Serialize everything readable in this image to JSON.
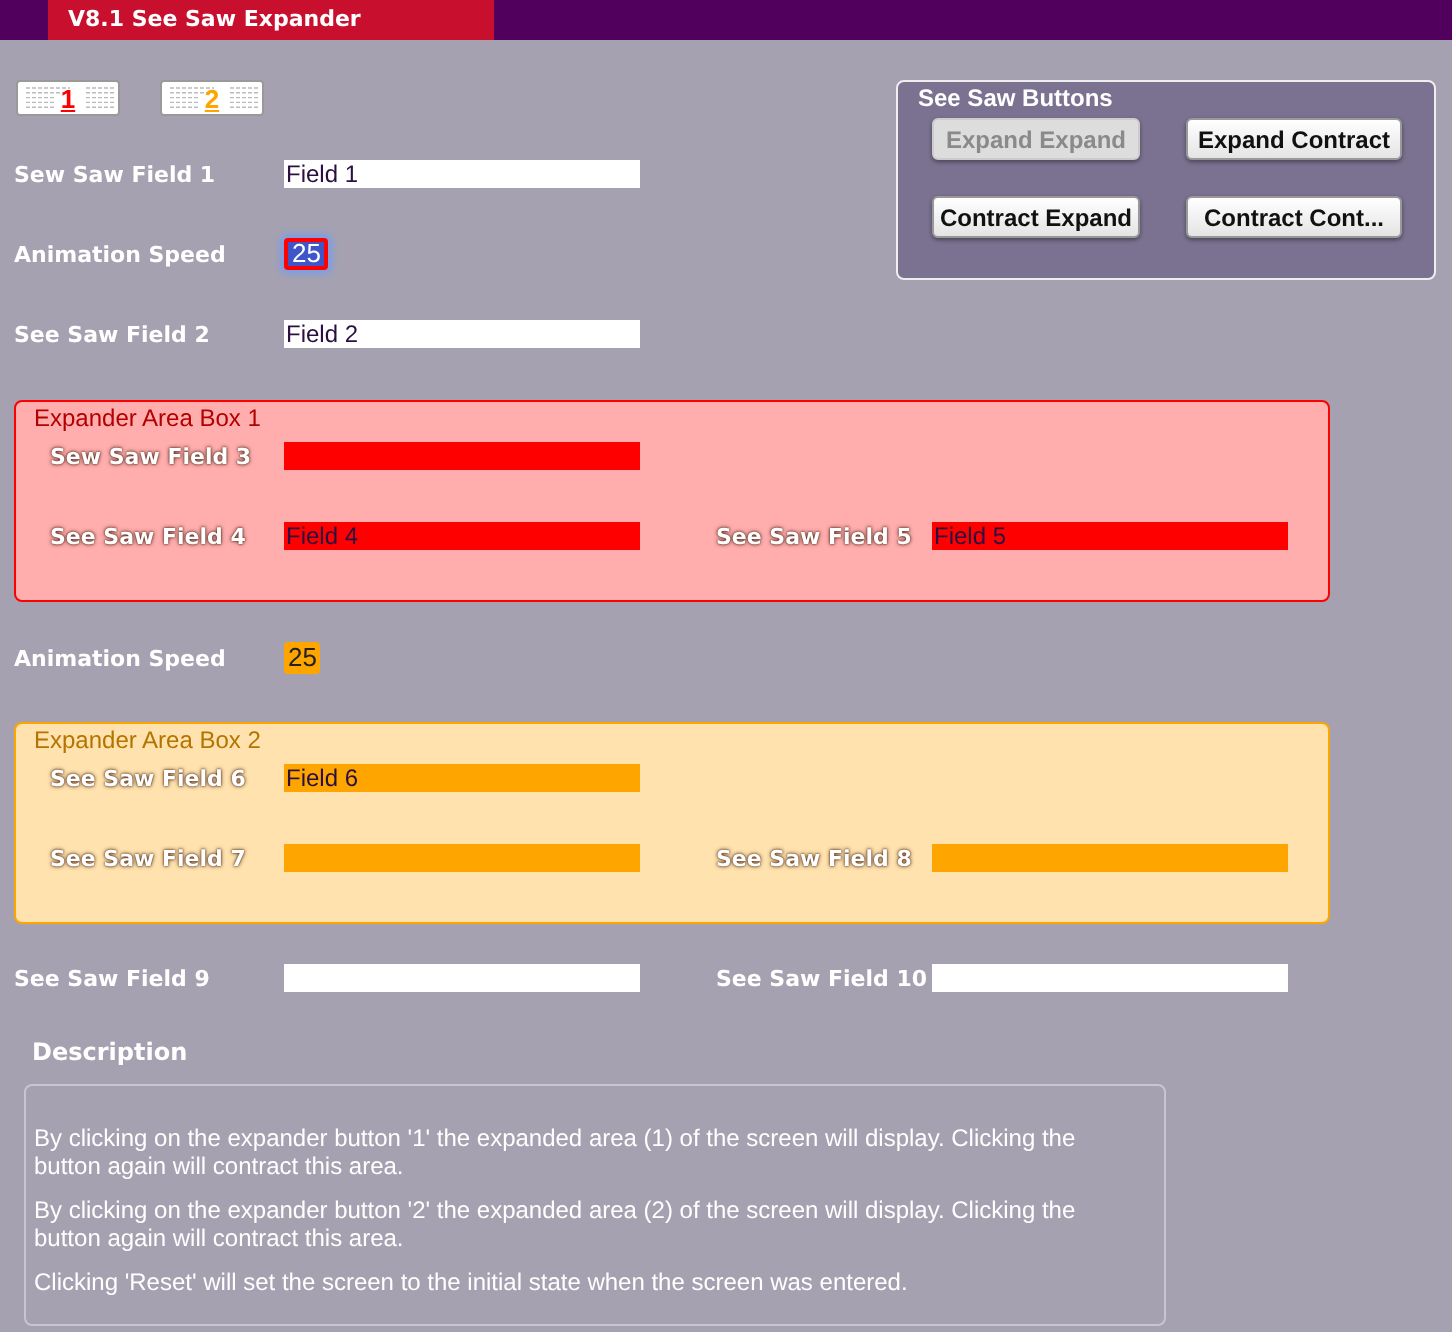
{
  "window": {
    "title": "V8.1 See Saw Expander"
  },
  "expander_buttons": [
    {
      "label": "1",
      "color": "#ff0000"
    },
    {
      "label": "2",
      "color": "#ffa500"
    }
  ],
  "top_rows": [
    {
      "kind": "field",
      "label": "Sew Saw Field 1",
      "value": "Field 1"
    },
    {
      "kind": "speed",
      "label": "Animation Speed",
      "value": "25",
      "selected": true,
      "color": "#ff0000"
    },
    {
      "kind": "field",
      "label": "See Saw Field 2",
      "value": "Field 2"
    }
  ],
  "button_panel": {
    "title": "See Saw Buttons",
    "buttons": [
      {
        "label": "Expand Expand",
        "disabled": true
      },
      {
        "label": "Expand Contract",
        "disabled": false
      },
      {
        "label": "Contract Expand",
        "disabled": false
      },
      {
        "label": "Contract Cont...",
        "disabled": false
      }
    ]
  },
  "sections": [
    {
      "kind": "box",
      "title": "Expander Area Box 1",
      "color": "#ff0000",
      "rows": [
        [
          {
            "label": "Sew Saw Field 3"
          }
        ],
        [
          {
            "label": "See Saw Field 4",
            "value": "Field 4"
          },
          {
            "label": "See Saw Field 5",
            "value": "Field 5"
          }
        ]
      ]
    },
    {
      "kind": "speed",
      "label": "Animation Speed",
      "value": "25",
      "selected": false,
      "color": "#ffa500"
    },
    {
      "kind": "box",
      "title": "Expander Area Box 2",
      "color": "#ffa500",
      "rows": [
        [
          {
            "label": "See Saw Field 6",
            "value": "Field 6"
          }
        ],
        [
          {
            "label": "See Saw Field 7"
          },
          {
            "label": "See Saw Field 8"
          }
        ]
      ]
    },
    {
      "kind": "row",
      "fields": [
        {
          "label": "See Saw Field 9"
        },
        {
          "label": "See Saw Field 10"
        }
      ]
    }
  ],
  "description": {
    "title": "Description",
    "paragraphs": [
      "By clicking on the expander button '1' the expanded area (1) of the screen will display. Clicking the button again will contract this area.",
      "By clicking on the expander button '2' the expanded area (2) of the screen will display. Clicking the button again will contract this area.",
      "Clicking 'Reset' will set the screen to the initial state when the screen was entered."
    ]
  }
}
